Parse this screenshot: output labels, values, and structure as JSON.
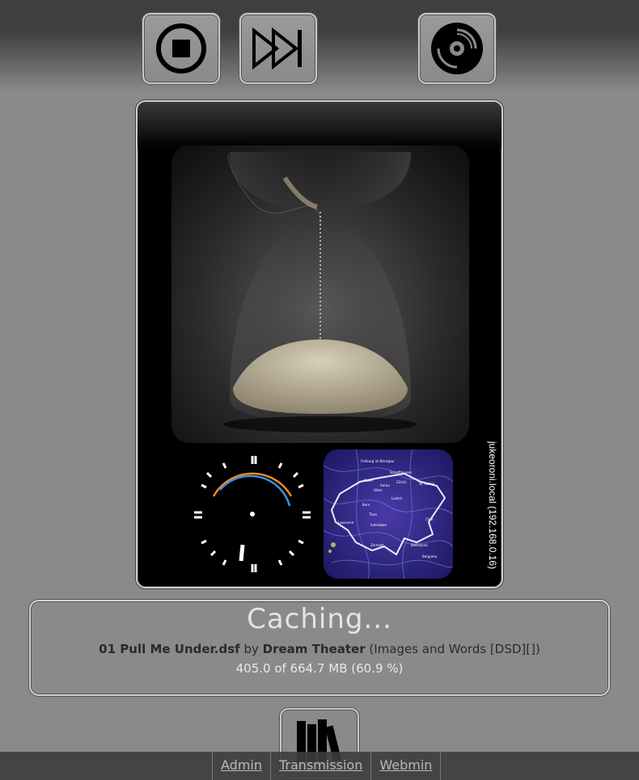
{
  "controls": {
    "stop": "stop-icon",
    "next": "skip-forward-icon",
    "disc": "disc-icon"
  },
  "host_label": "jukeoroni.local (192.168.0.16)",
  "status": {
    "title": "Caching...",
    "track": "01 Pull Me Under.dsf",
    "by": "by",
    "artist": "Dream Theater",
    "album": "(Images and Words [DSD][])",
    "progress_text": "405.0 of 664.7 MB (60.9 %)",
    "progress_fraction": 0.609
  },
  "map_labels": [
    "Freiburg im Breisgau",
    "Schaffhausen",
    "Basel",
    "Aarau",
    "Zürich",
    "St. Gallen",
    "Olten",
    "Luzern",
    "Bern",
    "Thun",
    "Lausanne",
    "Interlaken",
    "Zermatt",
    "Bellinzona",
    "Bergamo",
    "Chur"
  ],
  "footer": {
    "links": [
      "Admin",
      "Transmission",
      "Webmin"
    ]
  },
  "colors": {
    "background": "#8a8a8a",
    "panel": "#000000",
    "clock_arc_orange": "#f28a1e",
    "clock_arc_blue": "#3a8ee6"
  }
}
